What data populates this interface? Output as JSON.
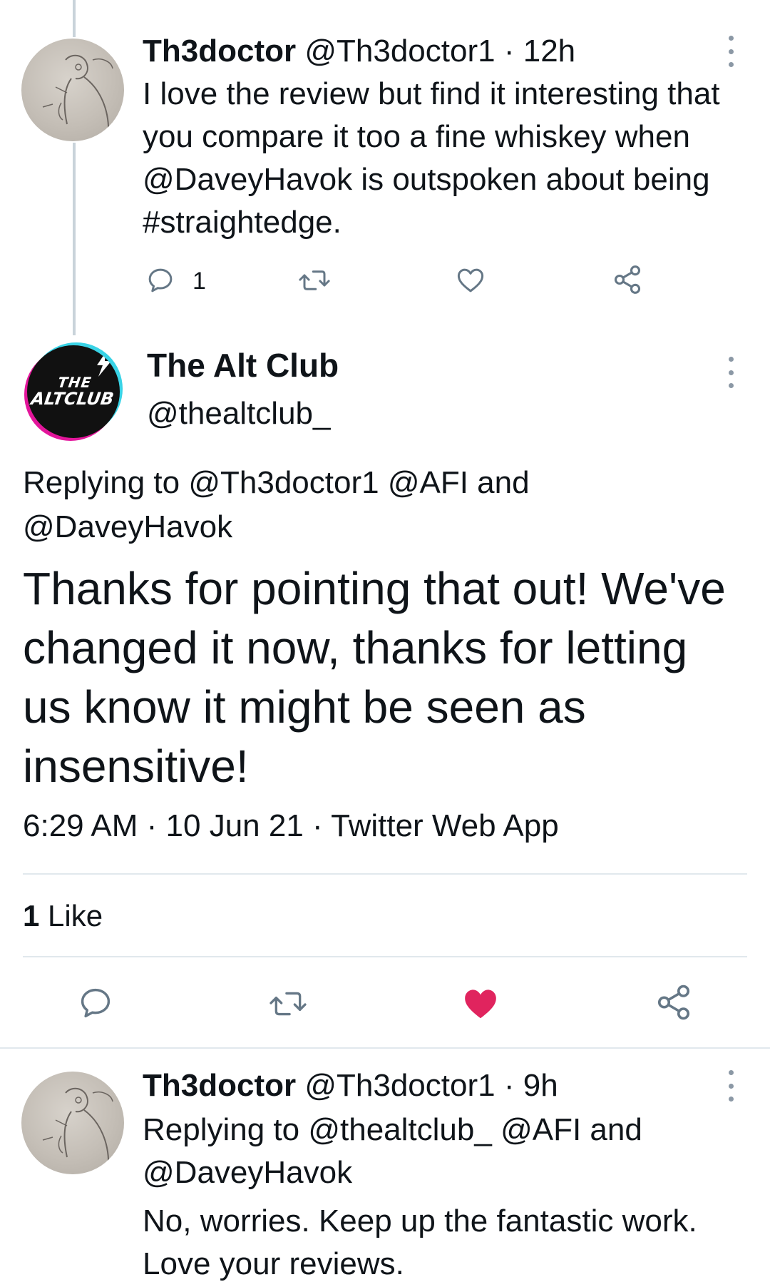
{
  "tweet1": {
    "display_name": "Th3doctor",
    "handle": "@Th3doctor1",
    "sep": "·",
    "time": "12h",
    "text": "I love the review but find it interesting that you compare it too a fine whiskey when @DaveyHavok is outspoken about being #straightedge.",
    "reply_count": "1"
  },
  "main_tweet": {
    "display_name": "The Alt Club",
    "handle": "@thealtclub_",
    "replying_to": "Replying to @Th3doctor1 @AFI and @DaveyHavok",
    "text": "Thanks for pointing that out! We've changed it now, thanks for letting us know it might be seen as insensitive!",
    "meta": "6:29 AM · 10 Jun 21 · Twitter Web App",
    "likes_count": "1",
    "likes_label": "Like",
    "avatar_text_line1": "THE",
    "avatar_text_line2": "ALTCLUB",
    "liked": true,
    "like_color": "#e0245e"
  },
  "tweet3": {
    "display_name": "Th3doctor",
    "handle": "@Th3doctor1",
    "sep": "·",
    "time": "9h",
    "replying_to": "Replying to @thealtclub_ @AFI and @DaveyHavok",
    "text": "No, worries. Keep up the fantastic work. Love your reviews."
  },
  "icons": {
    "reply": "reply-icon",
    "retweet": "retweet-icon",
    "like": "heart-icon",
    "share": "share-icon",
    "more": "more-vertical-icon"
  },
  "colors": {
    "text": "#0f1419",
    "icon": "#657786",
    "divider": "#e1e8ed",
    "thread_line": "#c9d3da"
  }
}
